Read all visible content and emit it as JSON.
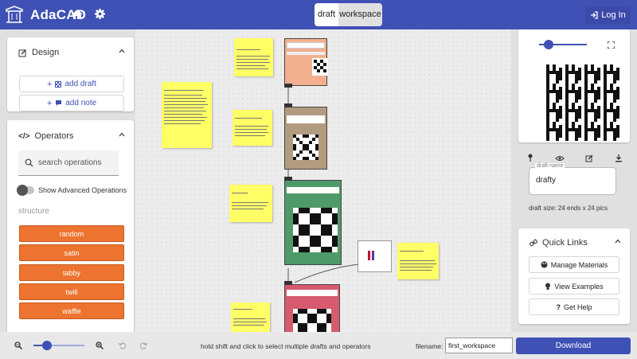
{
  "app": {
    "title": "AdaCAD"
  },
  "header": {
    "mode_tabs": [
      "draft",
      "workspace"
    ],
    "login_label": "Log In",
    "icons": [
      "home-icon",
      "gear-icon",
      "login-icon"
    ]
  },
  "left": {
    "design": {
      "title": "Design",
      "add_draft": "add draft",
      "add_note": "add note"
    },
    "operators": {
      "title": "Operators",
      "search_placeholder": "search operations",
      "advanced_label": "Show Advanced Operations",
      "section": "structure",
      "items": [
        "random",
        "satin",
        "tabby",
        "twill",
        "waffle"
      ]
    }
  },
  "right": {
    "draft_name_label": "draft name",
    "draft_name_value": "drafty",
    "draft_size": "draft size: 24 ends x 24 pics",
    "quick_links": {
      "title": "Quick Links",
      "items": [
        "Manage Materials",
        "View Examples",
        "Get Help"
      ]
    }
  },
  "bottom": {
    "hint": "hold shift and click to select multiple drafts and operators",
    "filename_label": "filename:",
    "filename_value": "first_workspace",
    "download_label": "Download"
  },
  "colors": {
    "primary": "#3f51b5",
    "operator": "#ec7430",
    "note": "#ffff66"
  }
}
